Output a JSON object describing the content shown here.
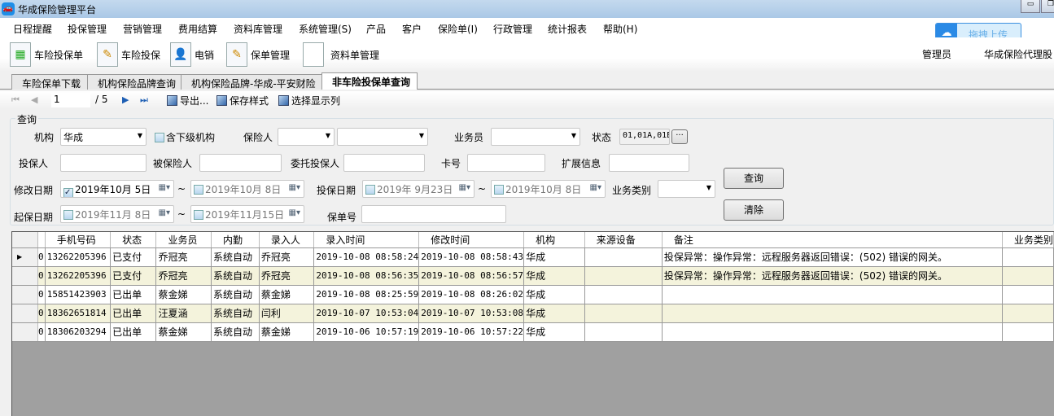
{
  "window": {
    "title": "华成保险管理平台",
    "min": "▭",
    "max": "❐"
  },
  "menu": [
    "日程提醒",
    "投保管理",
    "营销管理",
    "费用结算",
    "资料库管理",
    "系统管理(S)",
    "产品",
    "客户",
    "保险单(I)",
    "行政管理",
    "统计报表",
    "帮助(H)"
  ],
  "toolbar": [
    {
      "label": "车险投保单",
      "icon": "spreadsheet-icon"
    },
    {
      "label": "车险投保",
      "icon": "document-pen-icon"
    },
    {
      "label": "电销",
      "icon": "contact-card-icon"
    },
    {
      "label": "保单管理",
      "icon": "checklist-icon"
    },
    {
      "label": "资料单管理",
      "icon": "blank-document-icon"
    }
  ],
  "upload": {
    "label": "拖拽上传",
    "icon": "cloud-icon"
  },
  "user": {
    "name": "管理员",
    "company": "华成保险代理股"
  },
  "tabs": [
    "车险保单下载",
    "机构保险品牌查询",
    "机构保险品牌-华成-平安财险",
    "非车险投保单查询"
  ],
  "nav": {
    "page": "1",
    "total": "/ 5",
    "export": "导出...",
    "save_style": "保存样式",
    "columns": "选择显示列"
  },
  "query": {
    "legend": "查询",
    "org_label": "机构",
    "org_value": "华成",
    "sub_org_label": "含下级机构",
    "insurer_label": "保险人",
    "salesman_label": "业务员",
    "status_label": "状态",
    "status_value": "01,01A,01E",
    "status_btn": "···",
    "applicant_label": "投保人",
    "insured_label": "被保险人",
    "entrust_label": "委托投保人",
    "card_label": "卡号",
    "ext_label": "扩展信息",
    "mod_date_label": "修改日期",
    "mod_from": "2019年10月 5日",
    "mod_to": "2019年10月 8日",
    "apply_date_label": "投保日期",
    "apply_from": "2019年 9月23日",
    "apply_to": "2019年10月 8日",
    "biz_type_label": "业务类别",
    "start_date_label": "起保日期",
    "start_from": "2019年11月 8日",
    "start_to": "2019年11月15日",
    "policy_no_label": "保单号",
    "tilde": "~",
    "search_btn": "查询",
    "clear_btn": "清除"
  },
  "grid": {
    "columns": [
      "",
      "手机号码",
      "状态",
      "业务员",
      "内勤",
      "录入人",
      "录入时间",
      "修改时间",
      "机构",
      "来源设备",
      "备注",
      "业务类别"
    ],
    "rows": [
      [
        "0",
        "13262205396",
        "已支付",
        "乔冠亮",
        "系统自动",
        "乔冠亮",
        "2019-10-08 08:58:24",
        "2019-10-08 08:58:43",
        "华成",
        "",
        "投保异常：操作异常：远程服务器返回错误：(502) 错误的网关。",
        ""
      ],
      [
        "0",
        "13262205396",
        "已支付",
        "乔冠亮",
        "系统自动",
        "乔冠亮",
        "2019-10-08 08:56:35",
        "2019-10-08 08:56:57",
        "华成",
        "",
        "投保异常：操作异常：远程服务器返回错误：(502) 错误的网关。",
        ""
      ],
      [
        "0",
        "15851423903",
        "已出单",
        "蔡金娣",
        "系统自动",
        "蔡金娣",
        "2019-10-08 08:25:59",
        "2019-10-08 08:26:02",
        "华成",
        "",
        "",
        ""
      ],
      [
        "0",
        "18362651814",
        "已出单",
        "汪夏涵",
        "系统自动",
        "闫利",
        "2019-10-07 10:53:04",
        "2019-10-07 10:53:08",
        "华成",
        "",
        "",
        ""
      ],
      [
        "0",
        "18306203294",
        "已出单",
        "蔡金娣",
        "系统自动",
        "蔡金娣",
        "2019-10-06 10:57:19",
        "2019-10-06 10:57:22",
        "华成",
        "",
        "",
        ""
      ]
    ]
  }
}
